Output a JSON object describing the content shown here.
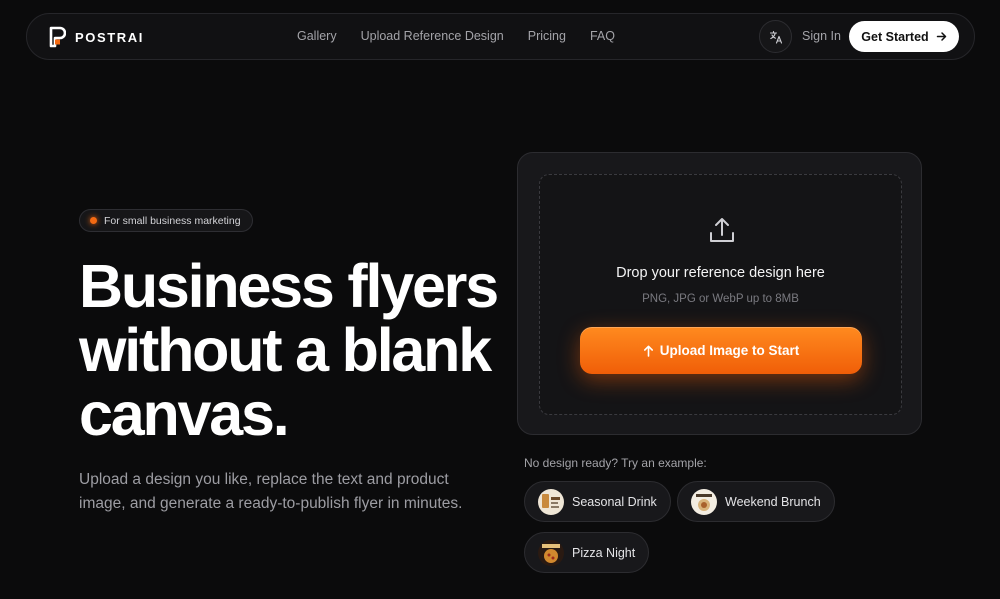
{
  "nav": {
    "logo_text": "POSTRAI",
    "links": [
      "Gallery",
      "Upload Reference Design",
      "Pricing",
      "FAQ"
    ],
    "sign_in": "Sign In",
    "cta": "Get Started"
  },
  "hero": {
    "badge": "For small business marketing",
    "headline_lines": [
      "Business flyers",
      "without a blank",
      "canvas."
    ],
    "subtext": "Upload a design you like, replace the text and product image, and generate a ready-to-publish flyer in minutes."
  },
  "upload": {
    "title": "Drop your reference design here",
    "hint": "PNG, JPG or WebP up to 8MB",
    "button": "Upload Image to Start"
  },
  "examples": {
    "label": "No design ready? Try an example:",
    "items": [
      "Seasonal Drink",
      "Weekend Brunch",
      "Pizza Night"
    ]
  },
  "colors": {
    "accent": "#f46a12",
    "background": "#0b0b0c"
  }
}
